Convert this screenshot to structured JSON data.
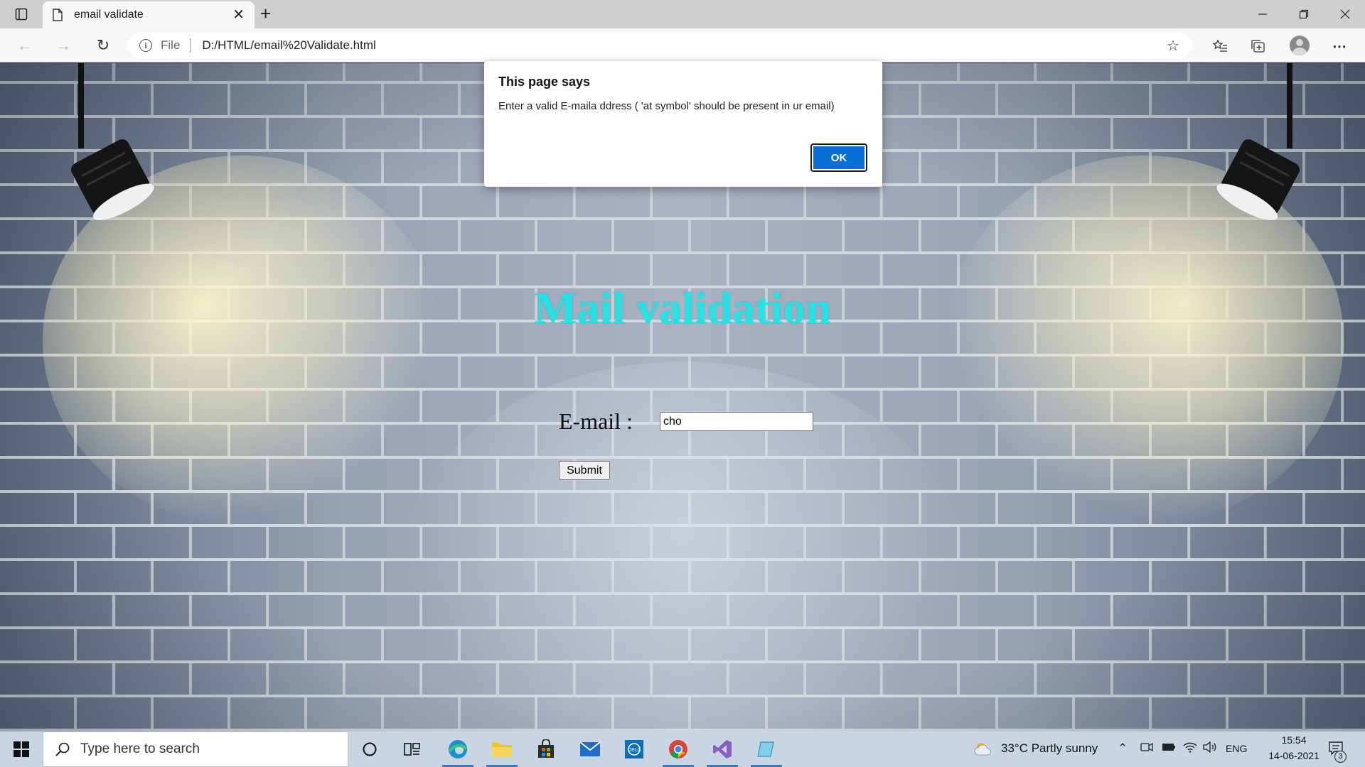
{
  "browser": {
    "tab_title": "email validate",
    "new_tab": "+",
    "url_scheme": "File",
    "url": "D:/HTML/email%20Validate.html"
  },
  "page": {
    "heading": "Mail validation",
    "email_label": "E-mail :",
    "email_value": "cho",
    "submit_label": "Submit"
  },
  "dialog": {
    "title": "This page says",
    "message": "Enter a valid E-maila ddress ( 'at symbol' should be present in ur email)",
    "ok_label": "OK"
  },
  "taskbar": {
    "search_placeholder": "Type here to search",
    "weather": "33°C  Partly sunny",
    "language": "ENG",
    "time": "15:54",
    "date": "14-06-2021",
    "notification_count": "3"
  },
  "colors": {
    "heading": "#22e3e6",
    "ok_button": "#0a6fd6"
  }
}
